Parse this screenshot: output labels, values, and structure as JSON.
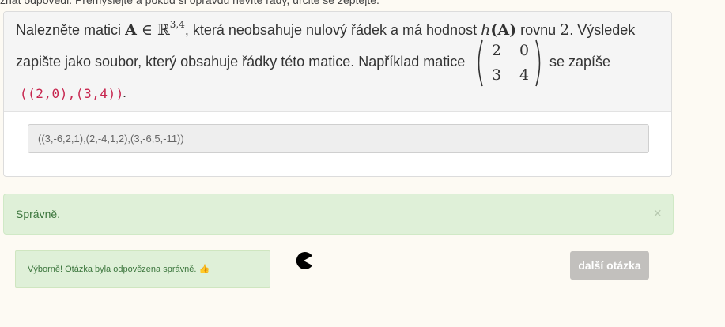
{
  "top_note": "znat odpovědi. Přemýšlejte a pokud si opravdu nevíte rady, určitě se zeptejte.",
  "question": {
    "part1": "Nalezněte matici ",
    "math_A": "A",
    "math_in": " ∈ ℝ",
    "math_dims": "3,4",
    "part2": ", která neobsahuje nulový řádek a má hodnost ",
    "math_h": "h",
    "math_hA": "(A)",
    "part3": " rovnu ",
    "math_two": "2",
    "part4": ". Výsledek",
    "line2_text": "zapište jako soubor, který obsahuje řádky této matice. Například matice",
    "line2_after": "se zapíše",
    "matrix": {
      "a11": "2",
      "a12": "0",
      "a21": "3",
      "a22": "4"
    },
    "example_code": "((2,0),(3,4))",
    "example_end": "."
  },
  "answer_value": "((3,-6,2,1),(2,-4,1,2),(3,-6,5,-11))",
  "alert": {
    "text": "Správně.",
    "close": "×"
  },
  "success": {
    "text": "Výborně! Otázka byla odpovězena správně. 👍"
  },
  "next_button": "další otázka"
}
